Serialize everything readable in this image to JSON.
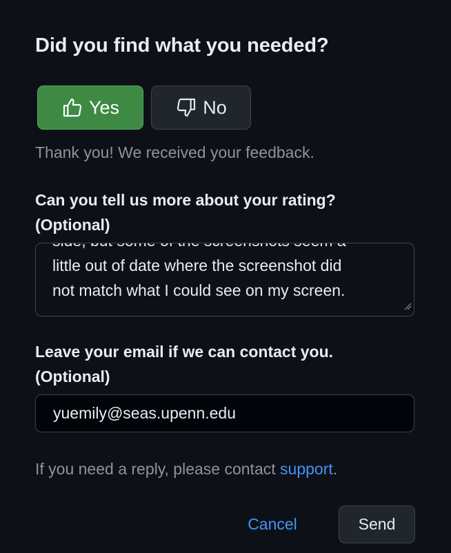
{
  "feedback": {
    "title": "Did you find what you needed?",
    "yes_label": "Yes",
    "no_label": "No",
    "thanks": "Thank you! We received your feedback.",
    "rating_label": "Can you tell us more about your rating?",
    "rating_optional": "(Optional)",
    "rating_text_lines": [
      "side, but some of the screenshots seem a",
      "little out of date where the screenshot did",
      "not match what I could see on my screen."
    ],
    "email_label": "Leave your email if we can contact you.",
    "email_optional": "(Optional)",
    "email_value": "yuemily@seas.upenn.edu",
    "reply_prefix": "If you need a reply, please contact ",
    "reply_link": "support",
    "reply_suffix": ".",
    "cancel_label": "Cancel",
    "send_label": "Send"
  },
  "colors": {
    "background": "#0d1117",
    "yes_button": "#3e8a45",
    "link": "#4493f8",
    "muted_text": "#8b949e"
  },
  "icons": {
    "yes": "thumbs-up-icon",
    "no": "thumbs-down-icon",
    "resize": "resize-handle-icon"
  }
}
